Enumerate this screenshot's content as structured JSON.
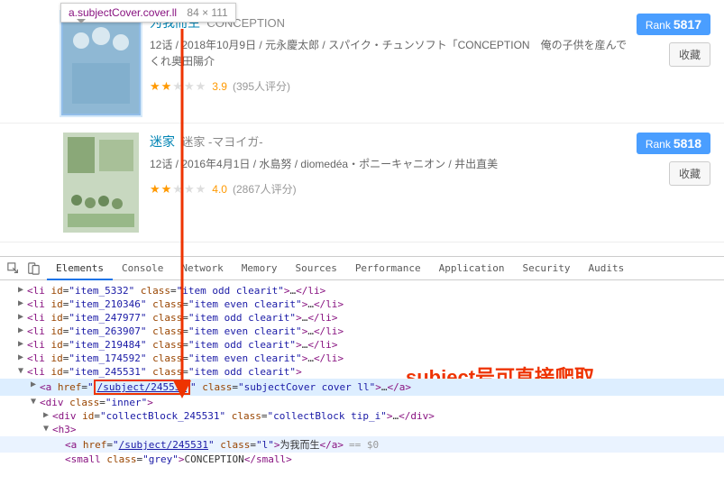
{
  "tooltip": {
    "selector": "a.subjectCover.cover.ll",
    "dimensions": "84 × 111"
  },
  "items": [
    {
      "title_main": "为我而生",
      "title_sub": "CONCEPTION",
      "meta": "12话 / 2018年10月9日 / 元永慶太郎 / スパイク・チュンソフト「CONCEPTION　俺の子供を産んでくれ奥田陽介",
      "stars_filled": 2,
      "score": "3.9",
      "count": "(395人评分)",
      "rank_label": "Rank",
      "rank_num": "5817",
      "collect": "收藏"
    },
    {
      "title_main": "迷家",
      "title_sub": "迷家 -マヨイガ-",
      "meta": "12话 / 2016年4月1日 / 水島努 / diomedéa・ポニーキャニオン / 井出直美",
      "stars_filled": 2,
      "score": "4.0",
      "count": "(2867人评分)",
      "rank_label": "Rank",
      "rank_num": "5818",
      "collect": "收藏"
    }
  ],
  "devtools": {
    "tabs": [
      "Elements",
      "Console",
      "Network",
      "Memory",
      "Sources",
      "Performance",
      "Application",
      "Security",
      "Audits"
    ],
    "active_tab": 0,
    "annotation": "subject号可直接爬取",
    "lines": [
      {
        "type": "li",
        "id": "item_5332",
        "cls": "item odd clearit",
        "indent": 0,
        "tw": "▶"
      },
      {
        "type": "li",
        "id": "item_210346",
        "cls": "item even clearit",
        "indent": 0,
        "tw": "▶"
      },
      {
        "type": "li",
        "id": "item_247977",
        "cls": "item odd clearit",
        "indent": 0,
        "tw": "▶"
      },
      {
        "type": "li",
        "id": "item_263907",
        "cls": "item even clearit",
        "indent": 0,
        "tw": "▶"
      },
      {
        "type": "li",
        "id": "item_219484",
        "cls": "item odd clearit",
        "indent": 0,
        "tw": "▶"
      },
      {
        "type": "li",
        "id": "item_174592",
        "cls": "item even clearit",
        "indent": 0,
        "tw": "▶"
      },
      {
        "type": "li_open",
        "id": "item_245531",
        "cls": "item odd clearit",
        "indent": 0,
        "tw": "▼"
      },
      {
        "type": "a_href",
        "href": "/subject/245531",
        "cls": "subjectCover cover ll",
        "indent": 1,
        "tw": "▶",
        "hl": "blue",
        "boxed": true
      },
      {
        "type": "div_open",
        "cls": "inner",
        "indent": 1,
        "tw": "▼"
      },
      {
        "type": "div_closed",
        "id": "collectBlock_245531",
        "cls": "collectBlock tip_i",
        "indent": 2,
        "tw": "▶"
      },
      {
        "type": "h3_open",
        "indent": 2,
        "tw": "▼"
      },
      {
        "type": "a_text",
        "href": "/subject/245531",
        "cls": "l",
        "text": "为我而生",
        "eq": "== $0",
        "indent": 3,
        "hl": "light"
      },
      {
        "type": "small",
        "cls": "grey",
        "text": "CONCEPTION",
        "indent": 3
      }
    ]
  }
}
